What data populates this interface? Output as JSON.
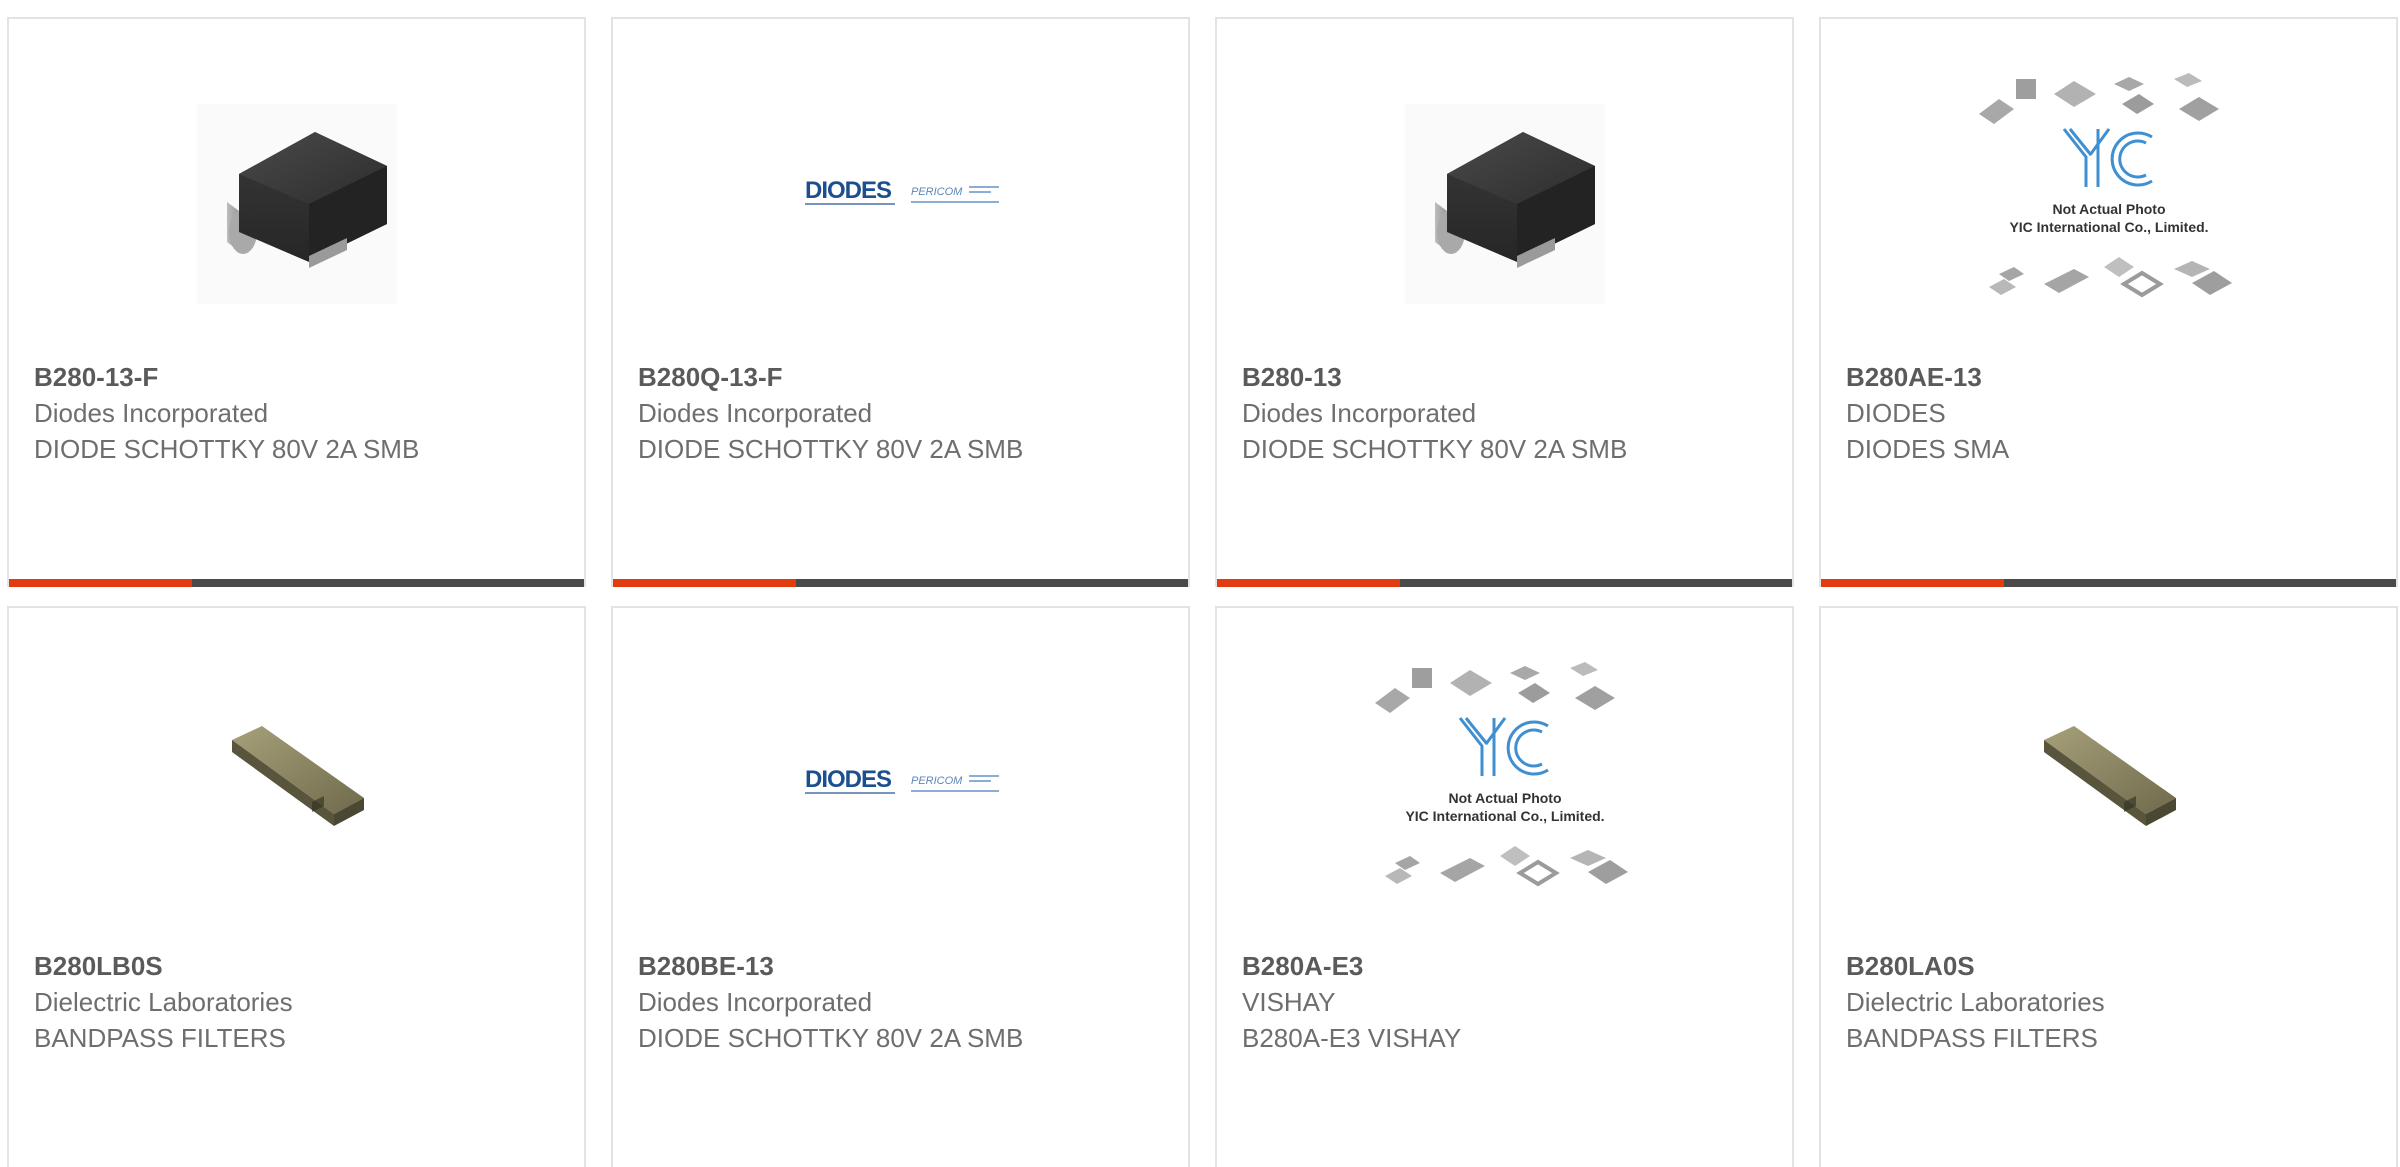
{
  "colors": {
    "accent": "#e23b10",
    "bar": "#4a4a4a",
    "card_border": "#e3e3e3",
    "text_part": "#5a5a5a",
    "text_meta": "#6e6e6e"
  },
  "products": [
    {
      "part_number": "B280-13-F",
      "manufacturer": "Diodes Incorporated",
      "description": "DIODE SCHOTTKY 80V 2A SMB",
      "image": "smb-diode-package-image"
    },
    {
      "part_number": "B280Q-13-F",
      "manufacturer": "Diodes Incorporated",
      "description": "DIODE SCHOTTKY 80V 2A SMB",
      "image": "diodes-pericom-logo-image"
    },
    {
      "part_number": "B280-13",
      "manufacturer": "Diodes Incorporated",
      "description": "DIODE SCHOTTKY 80V 2A SMB",
      "image": "smb-diode-package-image"
    },
    {
      "part_number": "B280AE-13",
      "manufacturer": "DIODES",
      "description": "DIODES SMA",
      "image": "yic-placeholder-image",
      "image_text": {
        "line1": "Not Actual Photo",
        "line2": "YIC International Co., Limited."
      }
    },
    {
      "part_number": "B280LB0S",
      "manufacturer": "Dielectric Laboratories",
      "description": "BANDPASS FILTERS",
      "image": "bandpass-filter-image"
    },
    {
      "part_number": "B280BE-13",
      "manufacturer": "Diodes Incorporated",
      "description": "DIODE SCHOTTKY 80V 2A SMB",
      "image": "diodes-pericom-logo-image"
    },
    {
      "part_number": "B280A-E3",
      "manufacturer": "VISHAY",
      "description": "B280A-E3 VISHAY",
      "image": "yic-placeholder-image",
      "image_text": {
        "line1": "Not Actual Photo",
        "line2": "YIC International Co., Limited."
      }
    },
    {
      "part_number": "B280LA0S",
      "manufacturer": "Dielectric Laboratories",
      "description": "BANDPASS FILTERS",
      "image": "bandpass-filter-image"
    }
  ],
  "logo_text": {
    "diodes": "DIODES",
    "pericom": "PERICOM"
  }
}
